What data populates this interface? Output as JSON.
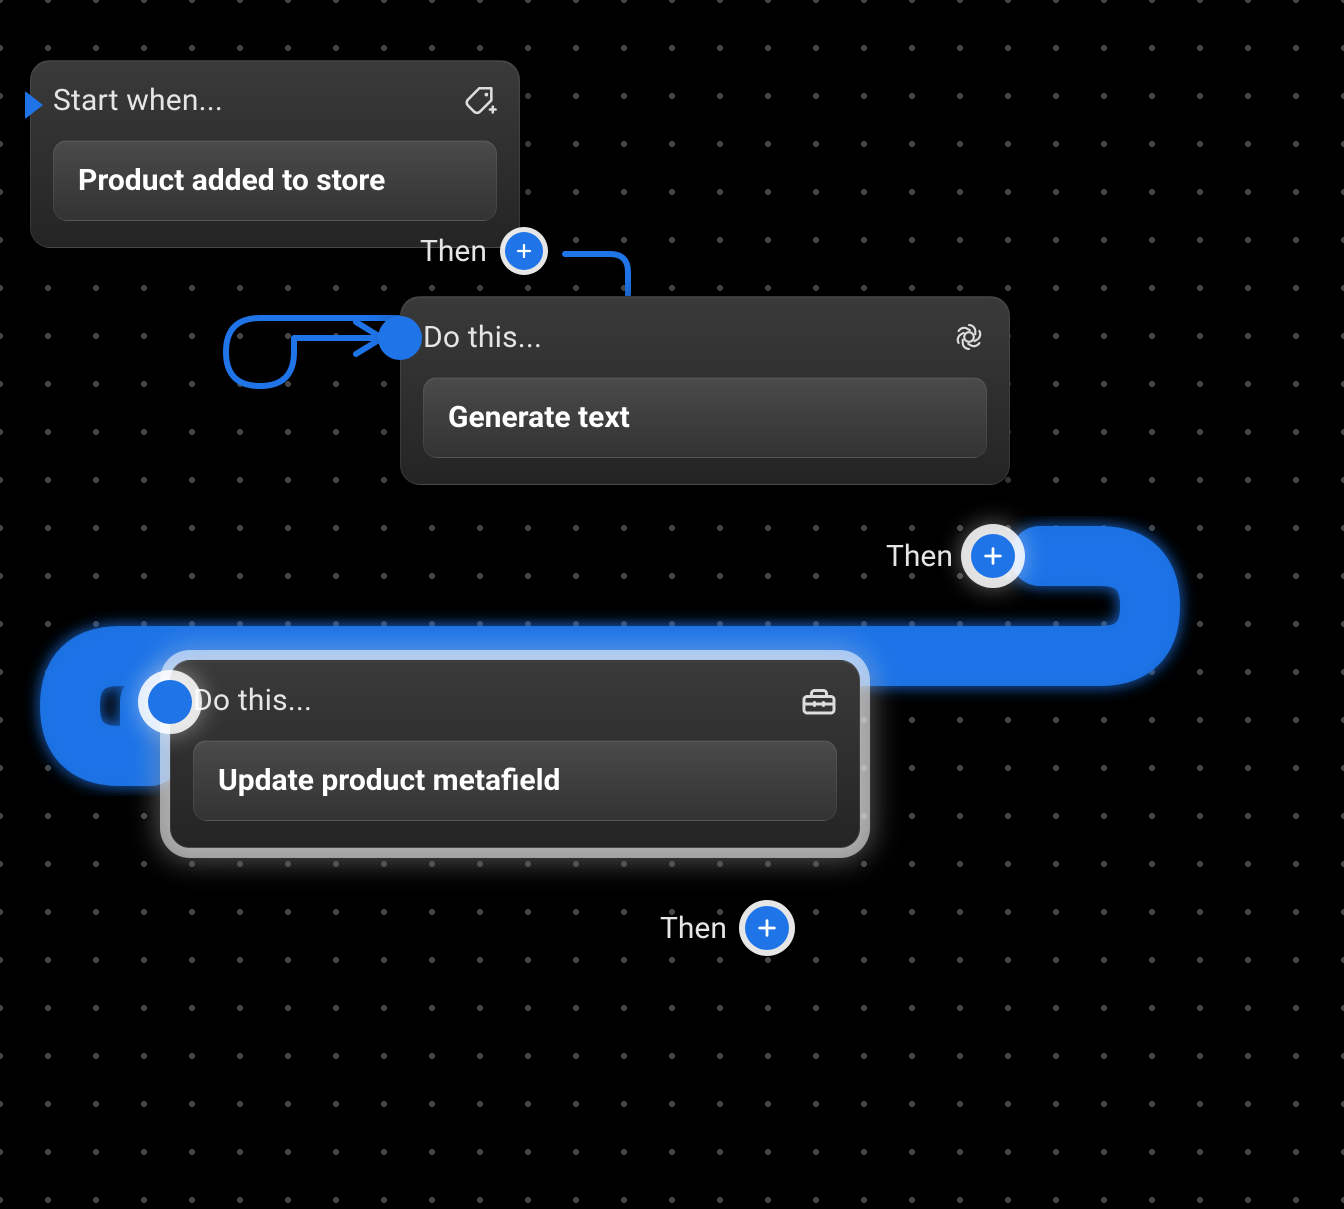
{
  "colors": {
    "accent": "#1f74e8",
    "card_bg_top": "#3a3a3a",
    "card_bg_bottom": "#242424",
    "text": "#ffffff",
    "background": "#000000"
  },
  "nodes": [
    {
      "id": "trigger",
      "header_label": "Start when...",
      "icon": "tag-plus",
      "body_label": "Product added to store",
      "then_label": "Then"
    },
    {
      "id": "action_generate_text",
      "header_label": "Do this...",
      "icon": "openai",
      "body_label": "Generate text",
      "then_label": "Then"
    },
    {
      "id": "action_update_metafield",
      "header_label": "Do this...",
      "icon": "toolbox",
      "body_label": "Update product metafield",
      "then_label": "Then"
    }
  ]
}
